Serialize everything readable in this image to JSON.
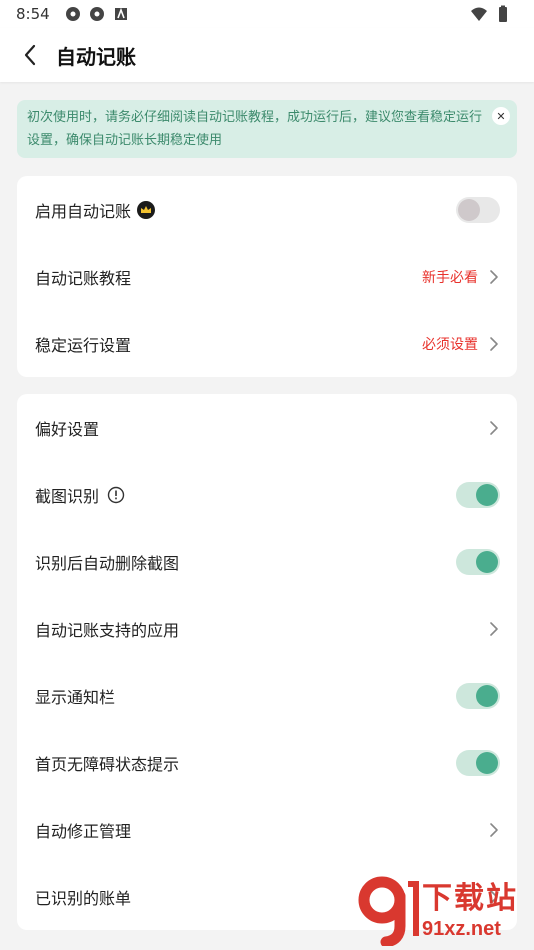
{
  "status_bar": {
    "time": "8:54"
  },
  "app_bar": {
    "title": "自动记账"
  },
  "notice": {
    "text": "初次使用时，请务必仔细阅读自动记账教程，成功运行后，建议您查看稳定运行设置，确保自动记账长期稳定使用"
  },
  "section1": {
    "items": [
      {
        "label": "启用自动记账",
        "type": "toggle",
        "on": false
      },
      {
        "label": "自动记账教程",
        "hint": "新手必看",
        "type": "link"
      },
      {
        "label": "稳定运行设置",
        "hint": "必须设置",
        "type": "link"
      }
    ]
  },
  "section2": {
    "items": [
      {
        "label": "偏好设置",
        "type": "link"
      },
      {
        "label": "截图识别",
        "type": "toggle",
        "on": true
      },
      {
        "label": "识别后自动删除截图",
        "type": "toggle",
        "on": true
      },
      {
        "label": "自动记账支持的应用",
        "type": "link"
      },
      {
        "label": "显示通知栏",
        "type": "toggle",
        "on": true
      },
      {
        "label": "首页无障碍状态提示",
        "type": "toggle",
        "on": true
      },
      {
        "label": "自动修正管理",
        "type": "link"
      },
      {
        "label": "已识别的账单",
        "type": "link"
      }
    ]
  },
  "watermark": {
    "top": "下载站",
    "bottom": "91xz.net"
  },
  "colors": {
    "accent": "#4aad8e",
    "hint": "#e8322c",
    "notice_bg": "#d8eee6",
    "notice_text": "#3c8a6c"
  }
}
